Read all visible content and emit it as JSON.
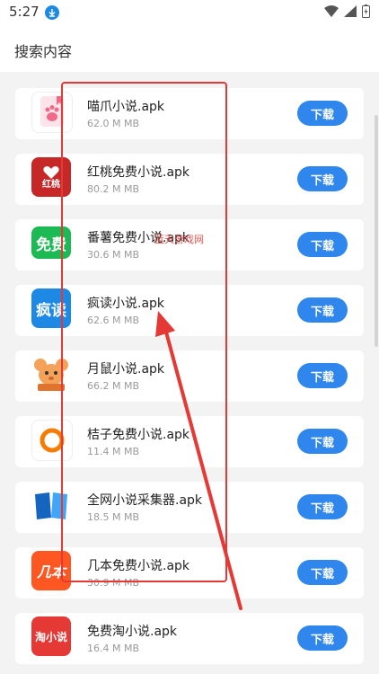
{
  "status": {
    "time": "5:27"
  },
  "header": {
    "title": "搜索内容"
  },
  "download_label": "下载",
  "watermark": "蓝天游戏网",
  "apps": [
    {
      "name": "喵爪小说.apk",
      "size": "62.0 M MB",
      "icon": "cat-paw-icon"
    },
    {
      "name": "红桃免费小说.apk",
      "size": "80.2 M MB",
      "icon": "red-heart-book-icon",
      "icon_text": "红桃"
    },
    {
      "name": "番薯免费小说.apk",
      "size": "30.6 M MB",
      "icon": "free-green-icon",
      "icon_text": "免费"
    },
    {
      "name": "疯读小说.apk",
      "size": "62.6 M MB",
      "icon": "fengdu-icon",
      "icon_text": "疯读"
    },
    {
      "name": "月鼠小说.apk",
      "size": "66.2 M MB",
      "icon": "mouse-icon"
    },
    {
      "name": "桔子免费小说.apk",
      "size": "11.4 M MB",
      "icon": "orange-ring-icon"
    },
    {
      "name": "全网小说采集器.apk",
      "size": "18.5 M MB",
      "icon": "open-book-icon"
    },
    {
      "name": "几本免费小说.apk",
      "size": "30.9 M MB",
      "icon": "jiben-icon",
      "icon_text": "几本"
    },
    {
      "name": "免费淘小说.apk",
      "size": "16.4 M MB",
      "icon": "tao-novel-icon",
      "icon_text": "淘小说"
    }
  ],
  "colors": {
    "accent": "#2f86ec",
    "annotation": "#e53935"
  }
}
